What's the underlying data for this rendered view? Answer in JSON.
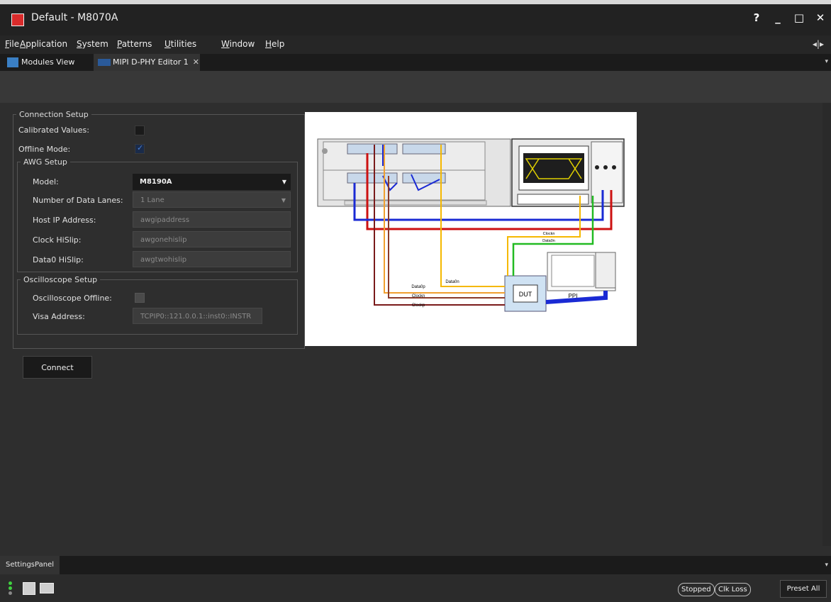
{
  "window": {
    "title": "Default - M8070A",
    "buttons": [
      "?",
      "_",
      "□",
      "✕"
    ]
  },
  "menu": {
    "items": [
      {
        "first": "F",
        "rest": "ile"
      },
      {
        "first": "A",
        "rest": "pplication"
      },
      {
        "first": "S",
        "rest": "ystem"
      },
      {
        "first": "P",
        "rest": "atterns"
      },
      {
        "first": "U",
        "rest": "tilities"
      },
      {
        "first": "W",
        "rest": "indow"
      },
      {
        "first": "H",
        "rest": "elp"
      }
    ],
    "pin": "◂|▸"
  },
  "tabs": {
    "modules": "Modules View",
    "editor": "MIPI D-PHY Editor 1",
    "close": "✕",
    "dropdown": "▾"
  },
  "connection_setup": {
    "legend": "Connection Setup",
    "calibrated_label": "Calibrated Values:",
    "calibrated": false,
    "offline_label": "Offline Mode:",
    "offline": true,
    "awg": {
      "legend": "AWG Setup",
      "model_label": "Model:",
      "model_value": "M8190A",
      "lanes_label": "Number of Data Lanes:",
      "lanes_value": "1 Lane",
      "host_label": "Host IP Address:",
      "host_value": "awgipaddress",
      "clock_label": "Clock HiSlip:",
      "clock_value": "awgonehislip",
      "data0_label": "Data0 HiSlip:",
      "data0_value": "awgtwohislip"
    },
    "osc": {
      "legend": "Oscilloscope Setup",
      "offline_label": "Oscilloscope Offline:",
      "visa_label": "Visa Address:",
      "visa_value": "TCPIP0::121.0.0.1::inst0::INSTR"
    }
  },
  "connect_button": "Connect",
  "diagram": {
    "labels": {
      "clockn_top": "Clockn",
      "data0n_top": "Data0n",
      "data0p": "Data0p",
      "clockn": "Clockn",
      "clockp": "Clockp",
      "data0n": "Data0n",
      "dut": "DUT",
      "ppi": "PPI"
    },
    "colors": {
      "red": "#cc1111",
      "blue": "#1a2ad4",
      "yellow": "#f5b800",
      "green": "#22bb22",
      "orange": "#f0a030",
      "darkred": "#7a1a1a",
      "brown": "#8a3a2a"
    }
  },
  "bottom_tab": "SettingsPanel",
  "status": {
    "stopped": "Stopped",
    "clk_loss": "Clk Loss",
    "preset": "Preset All"
  }
}
